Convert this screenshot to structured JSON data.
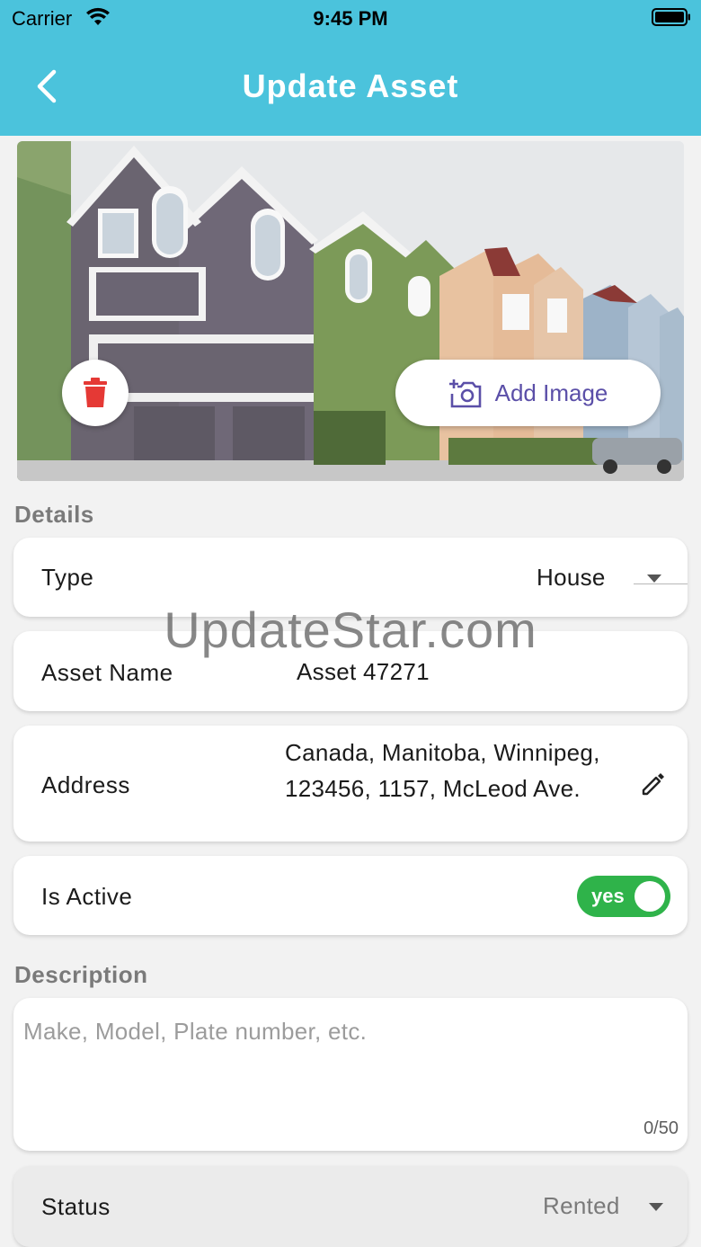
{
  "status_bar": {
    "carrier": "Carrier",
    "time": "9:45 PM"
  },
  "header": {
    "title": "Update Asset"
  },
  "image_section": {
    "add_image_label": "Add Image"
  },
  "details": {
    "section_label": "Details",
    "type": {
      "label": "Type",
      "value": "House"
    },
    "asset_name": {
      "label": "Asset Name",
      "value": "Asset 47271"
    },
    "address": {
      "label": "Address",
      "value": "Canada, Manitoba, Winnipeg, 123456, 1157, McLeod Ave."
    },
    "is_active": {
      "label": "Is Active",
      "toggle_label": "yes",
      "on": true
    }
  },
  "watermark": "UpdateStar.com",
  "description": {
    "section_label": "Description",
    "placeholder": "Make, Model, Plate number, etc.",
    "counter": "0/50"
  },
  "status_field": {
    "label": "Status",
    "value": "Rented"
  },
  "colors": {
    "header": "#4bc3dc",
    "accent_purple": "#5b4fa8",
    "delete_red": "#e53935",
    "toggle_green": "#2fb34a"
  }
}
